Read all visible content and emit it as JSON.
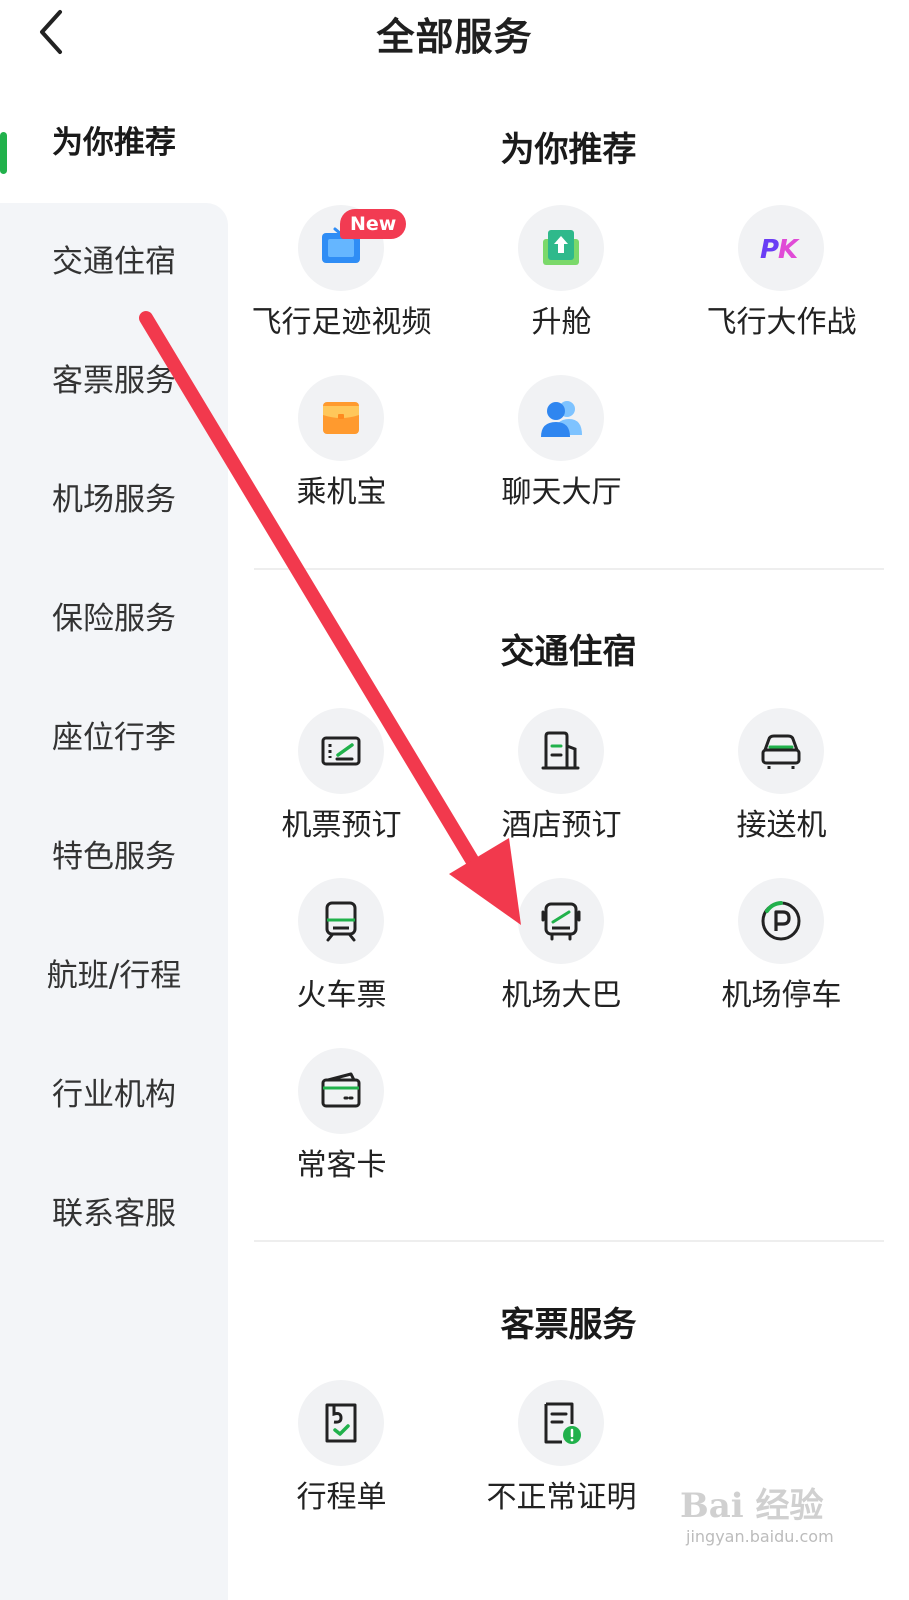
{
  "header": {
    "title": "全部服务",
    "back_icon": "chevron-left-icon"
  },
  "sidebar": {
    "active_color": "#21b14b",
    "items": [
      {
        "label": "为你推荐",
        "active": true
      },
      {
        "label": "交通住宿"
      },
      {
        "label": "客票服务"
      },
      {
        "label": "机场服务"
      },
      {
        "label": "保险服务"
      },
      {
        "label": "座位行李"
      },
      {
        "label": "特色服务"
      },
      {
        "label": "航班/行程"
      },
      {
        "label": "行业机构"
      },
      {
        "label": "联系客服"
      }
    ]
  },
  "sections": [
    {
      "title": "为你推荐",
      "items": [
        {
          "label": "飞行足迹视频",
          "icon": "video-icon",
          "badge": "New"
        },
        {
          "label": "升舱",
          "icon": "upgrade-icon"
        },
        {
          "label": "飞行大作战",
          "icon": "pk-icon"
        },
        {
          "label": "乘机宝",
          "icon": "wallet-icon"
        },
        {
          "label": "聊天大厅",
          "icon": "chat-users-icon"
        }
      ]
    },
    {
      "title": "交通住宿",
      "items": [
        {
          "label": "机票预订",
          "icon": "ticket-icon"
        },
        {
          "label": "酒店预订",
          "icon": "hotel-icon"
        },
        {
          "label": "接送机",
          "icon": "car-icon"
        },
        {
          "label": "火车票",
          "icon": "train-icon"
        },
        {
          "label": "机场大巴",
          "icon": "bus-icon"
        },
        {
          "label": "机场停车",
          "icon": "parking-icon"
        },
        {
          "label": "常客卡",
          "icon": "card-icon"
        }
      ]
    },
    {
      "title": "客票服务",
      "items": [
        {
          "label": "行程单",
          "icon": "itinerary-icon"
        },
        {
          "label": "不正常证明",
          "icon": "certificate-icon"
        }
      ]
    }
  ],
  "annotation": {
    "arrow_color": "#f2394d"
  },
  "watermark": {
    "main": "Bai 经验",
    "sub": "jingyan.baidu.com"
  }
}
